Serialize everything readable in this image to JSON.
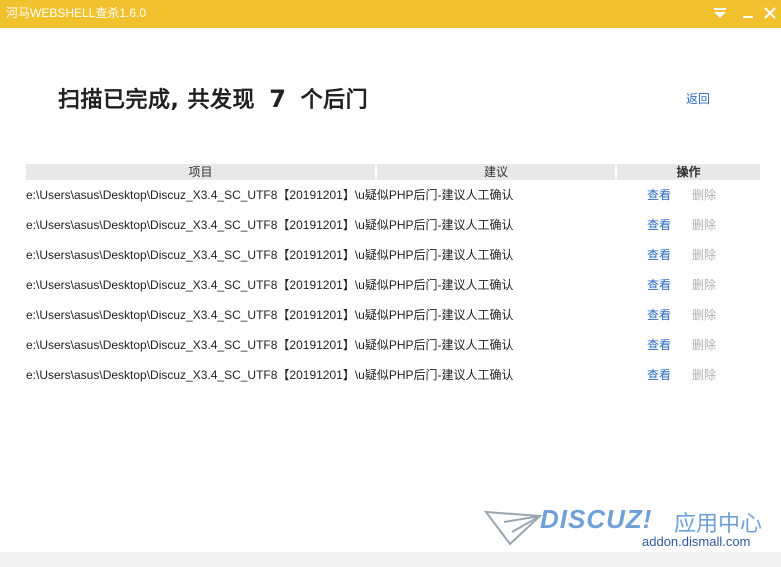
{
  "window": {
    "title": "河马WEBSHELL查杀1.6.0",
    "controls": [
      "menu-arrow-icon",
      "minimize-icon",
      "close-icon"
    ],
    "accent_color": "#f2c12e"
  },
  "summary": {
    "prefix": "扫描已完成, 共发现",
    "count": "7",
    "suffix": "个后门"
  },
  "back_label": "返回",
  "table": {
    "headers": [
      "项目",
      "建议",
      "操作"
    ],
    "rows": [
      {
        "path": "e:\\Users\\asus\\Desktop\\Discuz_X3.4_SC_UTF8【20191201】\\u",
        "advice": "疑似PHP后门-建议人工确认",
        "view": "查看",
        "delete": "删除"
      },
      {
        "path": "e:\\Users\\asus\\Desktop\\Discuz_X3.4_SC_UTF8【20191201】\\u",
        "advice": "疑似PHP后门-建议人工确认",
        "view": "查看",
        "delete": "删除"
      },
      {
        "path": "e:\\Users\\asus\\Desktop\\Discuz_X3.4_SC_UTF8【20191201】\\u",
        "advice": "疑似PHP后门-建议人工确认",
        "view": "查看",
        "delete": "删除"
      },
      {
        "path": "e:\\Users\\asus\\Desktop\\Discuz_X3.4_SC_UTF8【20191201】\\u",
        "advice": "疑似PHP后门-建议人工确认",
        "view": "查看",
        "delete": "删除"
      },
      {
        "path": "e:\\Users\\asus\\Desktop\\Discuz_X3.4_SC_UTF8【20191201】\\u",
        "advice": "疑似PHP后门-建议人工确认",
        "view": "查看",
        "delete": "删除"
      },
      {
        "path": "e:\\Users\\asus\\Desktop\\Discuz_X3.4_SC_UTF8【20191201】\\u",
        "advice": "疑似PHP后门-建议人工确认",
        "view": "查看",
        "delete": "删除"
      },
      {
        "path": "e:\\Users\\asus\\Desktop\\Discuz_X3.4_SC_UTF8【20191201】\\u",
        "advice": "疑似PHP后门-建议人工确认",
        "view": "查看",
        "delete": "删除"
      }
    ]
  },
  "watermark": {
    "brand": "DISCUZ!",
    "label": "应用中心",
    "url": "addon.dismall.com"
  }
}
